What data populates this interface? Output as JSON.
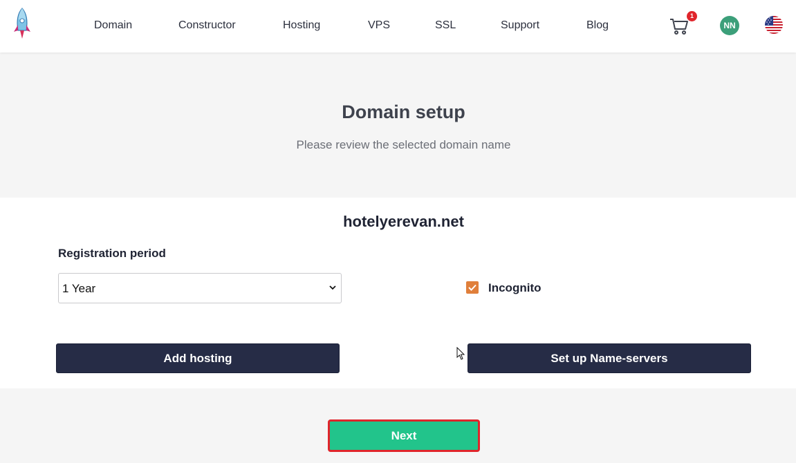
{
  "nav": {
    "items": [
      {
        "label": "Domain"
      },
      {
        "label": "Constructor"
      },
      {
        "label": "Hosting"
      },
      {
        "label": "VPS"
      },
      {
        "label": "SSL"
      },
      {
        "label": "Support"
      },
      {
        "label": "Blog"
      }
    ],
    "cart_count": "1",
    "avatar_initials": "NN",
    "language_flag": "us-flag-icon"
  },
  "page": {
    "title": "Domain setup",
    "subtitle": "Please review the selected domain name"
  },
  "domain": {
    "name": "hotelyerevan.net",
    "registration_label": "Registration period",
    "registration_value": "1 Year",
    "incognito_label": "Incognito",
    "incognito_checked": true
  },
  "actions": {
    "add_hosting": "Add hosting",
    "set_nameservers": "Set up Name-servers",
    "next": "Next"
  },
  "colors": {
    "primary_dark": "#262c46",
    "accent_green": "#22c48b",
    "checkbox_orange": "#e07f3b",
    "badge_red": "#e0252b",
    "avatar_green": "#3c9f7a"
  }
}
